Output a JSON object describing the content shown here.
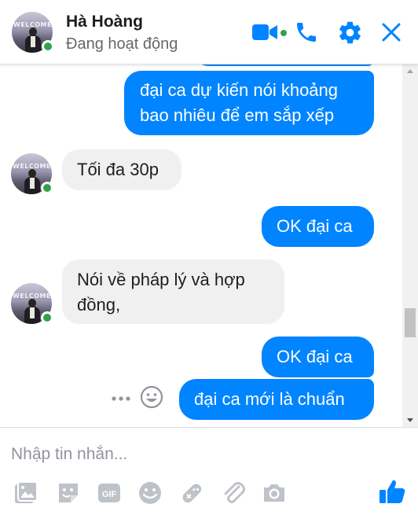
{
  "header": {
    "name": "Hà Hoàng",
    "status": "Đang hoạt động",
    "avatar_text": "WELCOME"
  },
  "colors": {
    "accent": "#0084ff",
    "online": "#31a24c",
    "incoming_bubble": "#f1f0f0",
    "icon_gray": "#bec2c9"
  },
  "icons": {
    "header": [
      "video-call-icon",
      "voice-call-icon",
      "settings-gear-icon",
      "close-icon"
    ],
    "composer": [
      "photo-icon",
      "sticker-icon",
      "gif-icon",
      "emoji-icon",
      "game-icon",
      "attachment-icon",
      "camera-icon",
      "like-thumb-icon"
    ]
  },
  "messages": [
    {
      "direction": "outgoing",
      "lines": [
        "đại ca dự kiến nói khoảng",
        "bao nhiêu để em sắp xếp"
      ]
    },
    {
      "direction": "incoming",
      "lines": [
        "Tối đa 30p"
      ]
    },
    {
      "direction": "outgoing",
      "lines": [
        "OK đại ca"
      ]
    },
    {
      "direction": "incoming",
      "lines": [
        "Nói về pháp lý và hợp",
        "đồng,"
      ]
    },
    {
      "direction": "outgoing",
      "lines": [
        "OK đại ca"
      ]
    },
    {
      "direction": "outgoing",
      "lines": [
        "đại ca mới là chuẩn"
      ]
    }
  ],
  "composer": {
    "placeholder": "Nhập tin nhắn...",
    "gif_label": "GIF"
  }
}
